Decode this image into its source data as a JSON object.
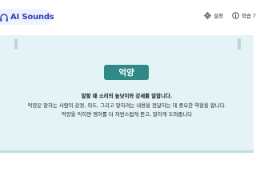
{
  "header": {
    "brand": "AI Sounds",
    "settings_label": "설정",
    "guide_label": "학습 가이드",
    "accent_color": "#2f3fb5"
  },
  "card": {
    "word": "억양",
    "title_line": "말할 때 소리의 높낮이와 강세를 말합니다.",
    "body_line_1": "억양은 말하는 사람의 감정, 의도, 그리고 말하려는 내용을 전달하는 데 중요한 역할을 합니다.",
    "body_line_2": "억양을 익히면 영어를 더 자연스럽게 듣고, 말하게 도와줍니다",
    "panel_color": "#e4f3f6",
    "badge_color": "#2f8a86"
  },
  "icons": {
    "logo": "headphones-icon",
    "settings": "gear-icon",
    "guide": "info-circle-icon"
  }
}
